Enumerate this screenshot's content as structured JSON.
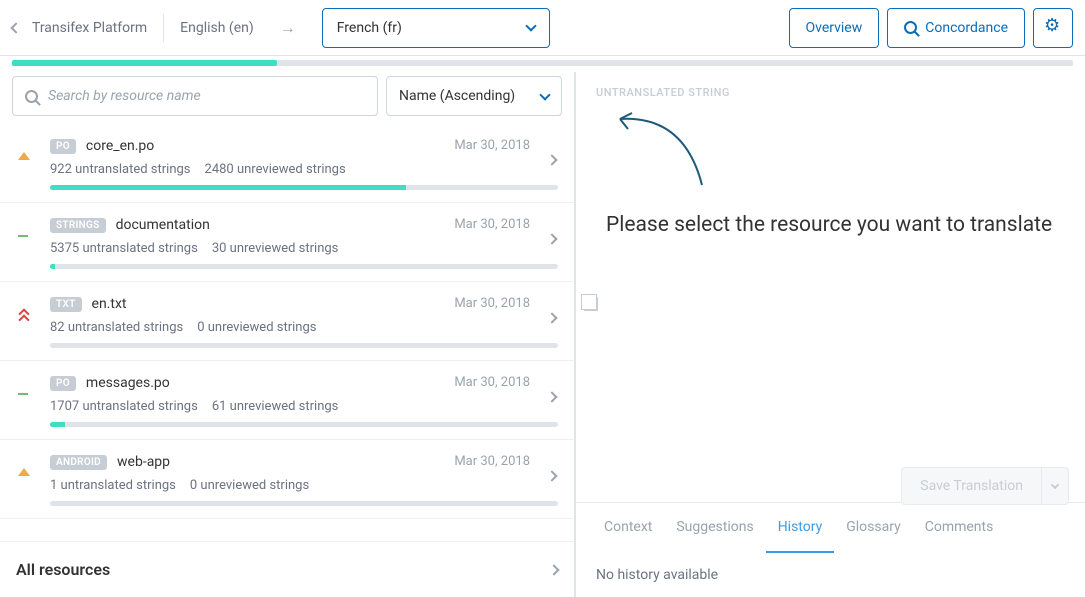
{
  "header": {
    "project_name": "Transifex Platform",
    "source_lang": "English (en)",
    "target_lang": "French (fr)",
    "overview_btn": "Overview",
    "concordance_btn": "Concordance"
  },
  "progress": {
    "percent": 25
  },
  "search": {
    "placeholder": "Search by resource name",
    "sort_label": "Name (Ascending)"
  },
  "resources": [
    {
      "badge": "PO",
      "name": "core_en.po",
      "date": "Mar 30, 2018",
      "untranslated": "922 untranslated strings",
      "unreviewed": "2480 unreviewed strings",
      "progress": 70,
      "status": "up"
    },
    {
      "badge": "STRINGS",
      "name": "documentation",
      "date": "Mar 30, 2018",
      "untranslated": "5375 untranslated strings",
      "unreviewed": "30 unreviewed strings",
      "progress": 1,
      "status": "minus"
    },
    {
      "badge": "TXT",
      "name": "en.txt",
      "date": "Mar 30, 2018",
      "untranslated": "82 untranslated strings",
      "unreviewed": "0 unreviewed strings",
      "progress": 0,
      "status": "dbl"
    },
    {
      "badge": "PO",
      "name": "messages.po",
      "date": "Mar 30, 2018",
      "untranslated": "1707 untranslated strings",
      "unreviewed": "61 unreviewed strings",
      "progress": 3,
      "status": "minus"
    },
    {
      "badge": "ANDROID",
      "name": "web-app",
      "date": "Mar 30, 2018",
      "untranslated": "1 untranslated strings",
      "unreviewed": "0 unreviewed strings",
      "progress": 0,
      "status": "up"
    }
  ],
  "all_resources_label": "All resources",
  "right": {
    "untranslated_label": "UNTRANSLATED STRING",
    "prompt": "Please select the resource you want to translate",
    "save_btn": "Save Translation",
    "no_history": "No history available"
  },
  "tabs": {
    "context": "Context",
    "suggestions": "Suggestions",
    "history": "History",
    "glossary": "Glossary",
    "comments": "Comments"
  }
}
